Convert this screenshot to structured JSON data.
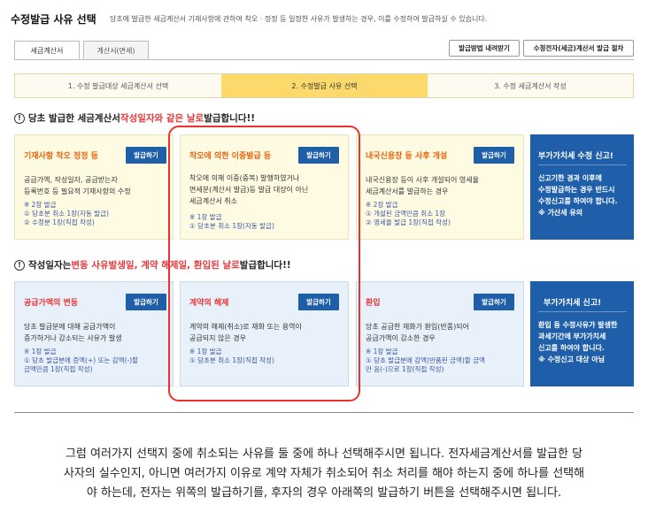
{
  "header": {
    "title": "수정발급 사유 선택",
    "subtitle": "당초에 발급한 세금계산서 기재사항에 관하여 착오 · 정정 등 일정한 사유가 발생하는 경우, 이를 수정하여 발급하실 수 있습니다."
  },
  "tabs": [
    {
      "label": "세금계산서",
      "active": true
    },
    {
      "label": "계산서(면세)",
      "active": false
    }
  ],
  "toolbar": {
    "method_download": "발급방법 내려받기",
    "procedure": "수정전자(세금)계산서 발급 절차"
  },
  "steps": [
    {
      "label": "1. 수정 발급대상 세금계산서 선택",
      "active": false
    },
    {
      "label": "2. 수정발급 사유 선택",
      "active": true
    },
    {
      "label": "3. 수정 세금계산서 작성",
      "active": false
    }
  ],
  "section1": {
    "prefix": "당초 발급한 세금계산서 ",
    "highlight": "작성일자와 같은 날로",
    "suffix": " 발급합니다!!",
    "cards": [
      {
        "title": "기재사항 착오 정정 등",
        "button": "발급하기",
        "desc": "공급가액, 작성일자, 공급받는자\n등록번호 등 필요적 기재사항의 수정",
        "note": "※ 2장 발급\n  ① 당초분 취소 1장(자동 발급)\n  ② 수정분 1장(직접 작성)"
      },
      {
        "title": "착오에 의한 이중발급 등",
        "button": "발급하기",
        "desc": "착오에 의해 이중(중복) 발행하였거나\n면세분(계산서 발급)등 발급 대상이 아닌\n세금계산서 취소",
        "note": "※ 1장 발급\n  ① 당초분 취소 1장(자동 발급)"
      },
      {
        "title": "내국신용장 등 사후 개설",
        "button": "발급하기",
        "desc": "내국신용장 등이 사후 개설되어 영세율\n세금계산서를 발급하는 경우",
        "note": "※ 2장 발급\n  ① 개설된 금액만큼 취소 1장\n  ② 영세율 발급 1장(직접 작성)"
      }
    ],
    "notice": {
      "title": "부가가치세 수정 신고!",
      "desc": "신고기한 경과 이후에\n수정발급하는 경우 반드시\n수정신고를 하여야 합니다.\n※ 가산세 유의"
    }
  },
  "section2": {
    "prefix": "작성일자는 ",
    "highlight": "변동 사유발생일, 계약 해제일, 환입된 날로",
    "suffix": " 발급합니다!!",
    "cards": [
      {
        "title": "공급가액의 변동",
        "button": "발급하기",
        "desc": "당초 발급분에 대해 공급가액이\n증가하거나 감소되는 사유가 발생",
        "note": "※ 1장 발급\n  ① 당초 발급분에 증액(+) 또는 감액(-)할\n  금액만큼 1장(직접 작성)"
      },
      {
        "title": "계약의 해제",
        "button": "발급하기",
        "desc": "계약의 해제(취소)로 재화 또는 용역이\n공급되지 않은 경우",
        "note": "※ 1장 발급\n  ① 당초분 취소 1장(직접 작성)"
      },
      {
        "title": "환입",
        "button": "발급하기",
        "desc": "당초 공급한 재화가 환입(반품)되어\n공급가액이 감소한 경우",
        "note": "※ 1장 발급\n  ① 당초 발급분에 감액(반품된 금액)할 금액\n  만 음(-)으로 1장(직접 작성)"
      }
    ],
    "notice": {
      "title": "부가가치세 신고!",
      "desc": "환입 등 수정사유가 발생한\n과세기간에 부가가치세\n신고를 하여야 합니다.\n※ 수정신고 대상 아님"
    }
  },
  "body_text": "그럼 여러가지 선택지 중에 취소되는 사유를 둘 중에 하나 선택해주시면 됩니다. 전자세금계산서를 발급한 당\n사자의 실수인지, 아니면 여러가지 이유로 계약 자체가 취소되어 취소 처리를 해야 하는지 중에 하나를 선택해\n야 하는데, 전자는 위쪽의 발급하기를, 후자의 경우 아래쪽의 발급하기 버튼을 선택해주시면 됩니다.",
  "colors": {
    "accent": "#1f5faa",
    "highlight_step": "#fbd96b",
    "warn": "#e8383c",
    "orange": "#e8640c"
  }
}
